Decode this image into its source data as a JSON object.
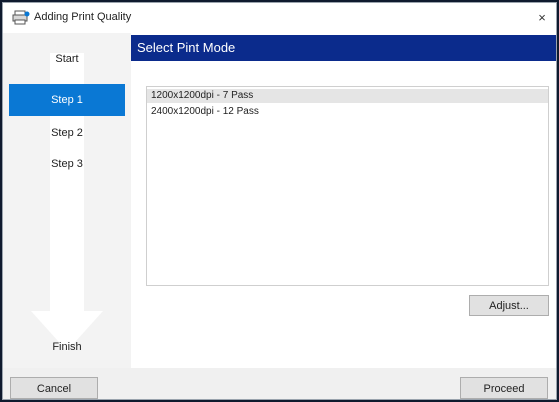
{
  "window": {
    "title": "Adding Print Quality",
    "close_glyph": "×"
  },
  "sidebar": {
    "steps": [
      {
        "label": "Start",
        "active": false
      },
      {
        "label": "Step 1",
        "active": true
      },
      {
        "label": "Step 2",
        "active": false
      },
      {
        "label": "Step 3",
        "active": false
      },
      {
        "label": "Finish",
        "active": false
      }
    ]
  },
  "main": {
    "header": "Select Pint Mode",
    "modes": [
      {
        "label": "1200x1200dpi - 7 Pass",
        "selected": true
      },
      {
        "label": "2400x1200dpi - 12 Pass",
        "selected": false
      }
    ],
    "adjust_label": "Adjust..."
  },
  "footer": {
    "cancel_label": "Cancel",
    "proceed_label": "Proceed"
  },
  "colors": {
    "header_bg": "#0b2b8c",
    "active_step_bg": "#0a78d4"
  }
}
